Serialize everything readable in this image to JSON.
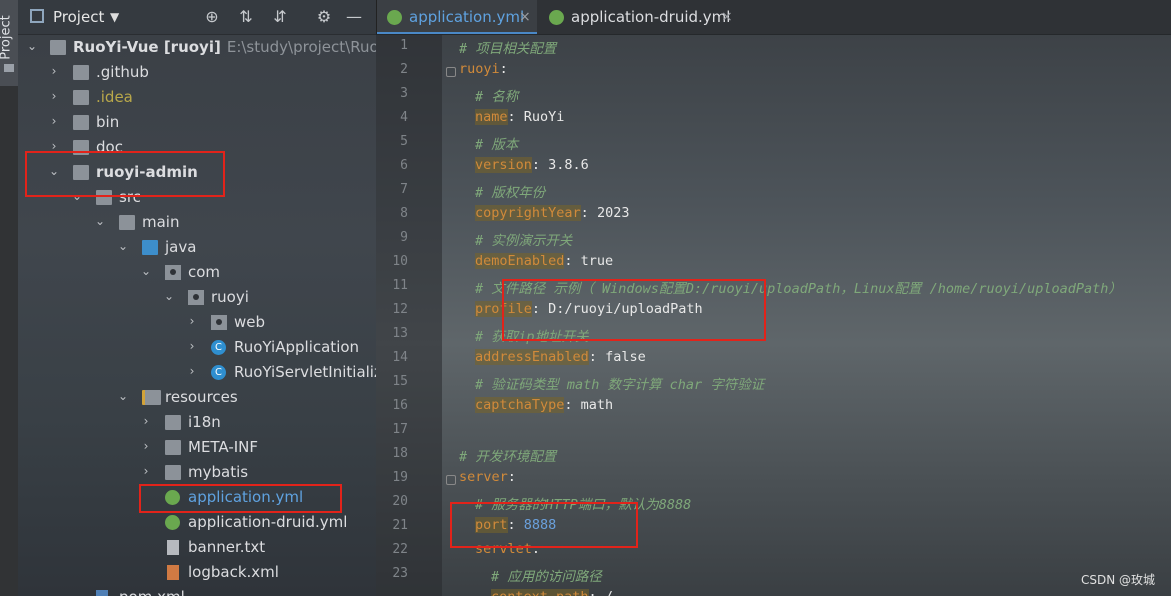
{
  "sidebar_stripe": {
    "label": "Project"
  },
  "panel": {
    "title": "Project",
    "buttons": [
      "locate-icon",
      "expand-all-icon",
      "collapse-all-icon",
      "gear-icon",
      "minimize-icon"
    ]
  },
  "tree": {
    "root": {
      "name": "RuoYi-Vue [ruoyi]",
      "path": "E:\\study\\project\\RuoYi-Vue"
    },
    "github": ".github",
    "idea": ".idea",
    "bin": "bin",
    "doc": "doc",
    "admin": "ruoyi-admin",
    "src": "src",
    "main": "main",
    "java": "java",
    "com": "com",
    "ruoyi": "ruoyi",
    "web": "web",
    "app": "RuoYiApplication",
    "servlet": "RuoYiServletInitialize",
    "resources": "resources",
    "i18n": "i18n",
    "metainf": "META-INF",
    "mybatis": "mybatis",
    "appyml": "application.yml",
    "druidyml": "application-druid.yml",
    "banner": "banner.txt",
    "logback": "logback.xml",
    "pom": "pom.xml"
  },
  "tabs": [
    {
      "label": "application.yml",
      "active": true
    },
    {
      "label": "application-druid.yml",
      "active": false
    }
  ],
  "code": {
    "l1": "# 项目相关配置",
    "l2k": "ruoyi",
    "l3": "# 名称",
    "l4k": "name",
    "l4v": "RuoYi",
    "l5": "# 版本",
    "l6k": "version",
    "l6v": "3.8.6",
    "l7": "# 版权年份",
    "l8k": "copyrightYear",
    "l8v": "2023",
    "l9": "# 实例演示开关",
    "l10k": "demoEnabled",
    "l10v": "true",
    "l11": "# 文件路径 示例（ Windows配置D:/ruoyi/uploadPath，Linux配置 /home/ruoyi/uploadPath）",
    "l12k": "profile",
    "l12v": "D:/ruoyi/uploadPath",
    "l13": "# 获取ip地址开关",
    "l14k": "addressEnabled",
    "l14v": "false",
    "l15": "# 验证码类型 math 数字计算 char 字符验证",
    "l16k": "captchaType",
    "l16v": "math",
    "l18": "# 开发环境配置",
    "l19k": "server",
    "l20": "# 服务器的HTTP端口，默认为8888",
    "l21k": "port",
    "l21v": "8888",
    "l22k": "servlet",
    "l23": "# 应用的访问路径",
    "l24k": "context-path",
    "l24v": "/"
  },
  "line_numbers": [
    "1",
    "2",
    "3",
    "4",
    "5",
    "6",
    "7",
    "8",
    "9",
    "10",
    "11",
    "12",
    "13",
    "14",
    "15",
    "16",
    "17",
    "18",
    "19",
    "20",
    "21",
    "22",
    "23"
  ],
  "watermark": "CSDN @玫城"
}
